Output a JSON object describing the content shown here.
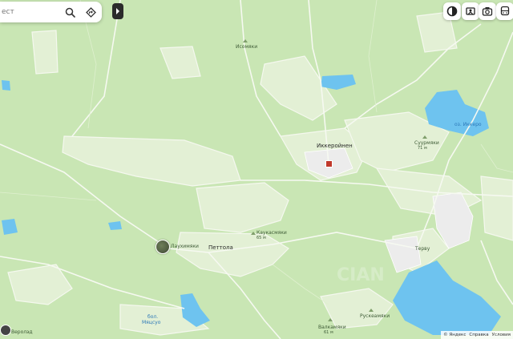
{
  "search": {
    "placeholder": "ест"
  },
  "labels": {
    "isomyaki": "Исомяки",
    "ikkeroinen": "Иккеройнен",
    "ozero": "оз. Иккеро",
    "suurmyaki": "Суурмяки",
    "suurmyaki_h": "71 м",
    "kaukasmyaki": "Каукасмяки",
    "kaukasmyaki_h": "65 м",
    "lauhimyaki": "Лаухимяки",
    "pettola": "Петтола",
    "terva": "Терву",
    "bol_myatsyu": "бол.",
    "bol_myatsyu2": "Мяцсуо",
    "valkamyaki": "Валкамяки",
    "valkamyaki_h": "61 м",
    "ruskeamyaki": "Рускеамяки",
    "veroyal": "Веролэд"
  },
  "copyright": {
    "brand": "© Яндекс",
    "help": "Справка",
    "terms": "Условия"
  },
  "colors": {
    "forest": "#c9e6b4",
    "field": "#e4f1d6",
    "water": "#6ec3ef",
    "road": "#f4f7ee",
    "urban": "#e9ede4"
  }
}
